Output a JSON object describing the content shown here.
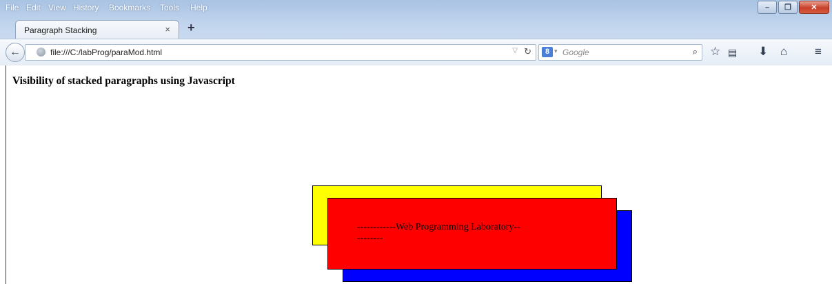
{
  "menubar": {
    "items": [
      "File",
      "Edit",
      "View",
      "History",
      "Bookmarks",
      "Tools",
      "Help"
    ]
  },
  "tab": {
    "title": "Paragraph Stacking",
    "close_glyph": "×",
    "new_tab_glyph": "+"
  },
  "navbar": {
    "url": "file:///C:/labProg/paraMod.html",
    "search_engine_glyph": "8",
    "search_placeholder": "Google",
    "icons": [
      "back-icon",
      "globe-icon",
      "dropdown-icon",
      "reload-icon",
      "search-icon",
      "bookmark-star-icon",
      "reading-list-icon",
      "download-icon",
      "home-icon",
      "menu-icon"
    ]
  },
  "page": {
    "heading": "Visibility of stacked paragraphs using Javascript",
    "paragraphs": [
      {
        "id": "yellow",
        "color": "#ffff00",
        "text": ""
      },
      {
        "id": "blue",
        "color": "#0000ff",
        "text": ""
      },
      {
        "id": "red",
        "color": "#ff0000",
        "text": "------------Web Programming Laboratory----------"
      }
    ]
  },
  "window_buttons": {
    "minimize": "–",
    "maximize": "❐",
    "close": "✕"
  }
}
